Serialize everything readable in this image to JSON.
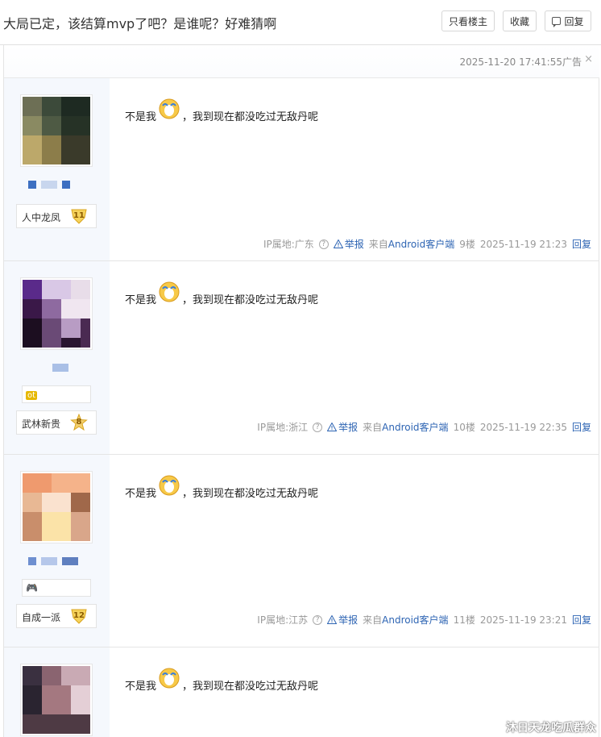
{
  "thread": {
    "title": "大局已定，该结算mvp了吧？是谁呢？好难猜啊",
    "only_op_label": "只看楼主",
    "favorite_label": "收藏",
    "reply_label": "回复"
  },
  "ad": {
    "timestamp": "2025-11-20 17:41:55",
    "label": "广告",
    "close": "×"
  },
  "colors": {
    "link": "#2d64b3",
    "meta_gray": "#999999",
    "sidebar_bg": "#f5f8fd"
  },
  "posts": [
    {
      "text_before": "不是我",
      "text_after": "，我到现在都没吃过无敌丹呢",
      "emoji": "crying-face-icon",
      "level_name": "人中龙凤",
      "level": "11",
      "ip_label": "IP属地:广东",
      "report": "举报",
      "source_prefix": "来自",
      "source": "Android客户端",
      "floor": "9楼",
      "time": "2025-11-19 21:23",
      "reply": "回复"
    },
    {
      "text_before": "不是我",
      "text_after": "，我到现在都没吃过无敌丹呢",
      "emoji": "crying-face-icon",
      "medal": "ot",
      "level_name": "武林新贵",
      "level": "8",
      "ip_label": "IP属地:浙江",
      "report": "举报",
      "source_prefix": "来自",
      "source": "Android客户端",
      "floor": "10楼",
      "time": "2025-11-19 22:35",
      "reply": "回复"
    },
    {
      "text_before": "不是我",
      "text_after": "，我到现在都没吃过无敌丹呢",
      "emoji": "crying-face-icon",
      "medal": "🎮",
      "level_name": "自成一派",
      "level": "12",
      "ip_label": "IP属地:江苏",
      "report": "举报",
      "source_prefix": "来自",
      "source": "Android客户端",
      "floor": "11楼",
      "time": "2025-11-19 23:21",
      "reply": "回复"
    },
    {
      "text_before": "不是我",
      "text_after": "，我到现在都没吃过无敌丹呢",
      "emoji": "crying-face-icon"
    }
  ],
  "watermark": "沐日天龙吃瓜群众"
}
